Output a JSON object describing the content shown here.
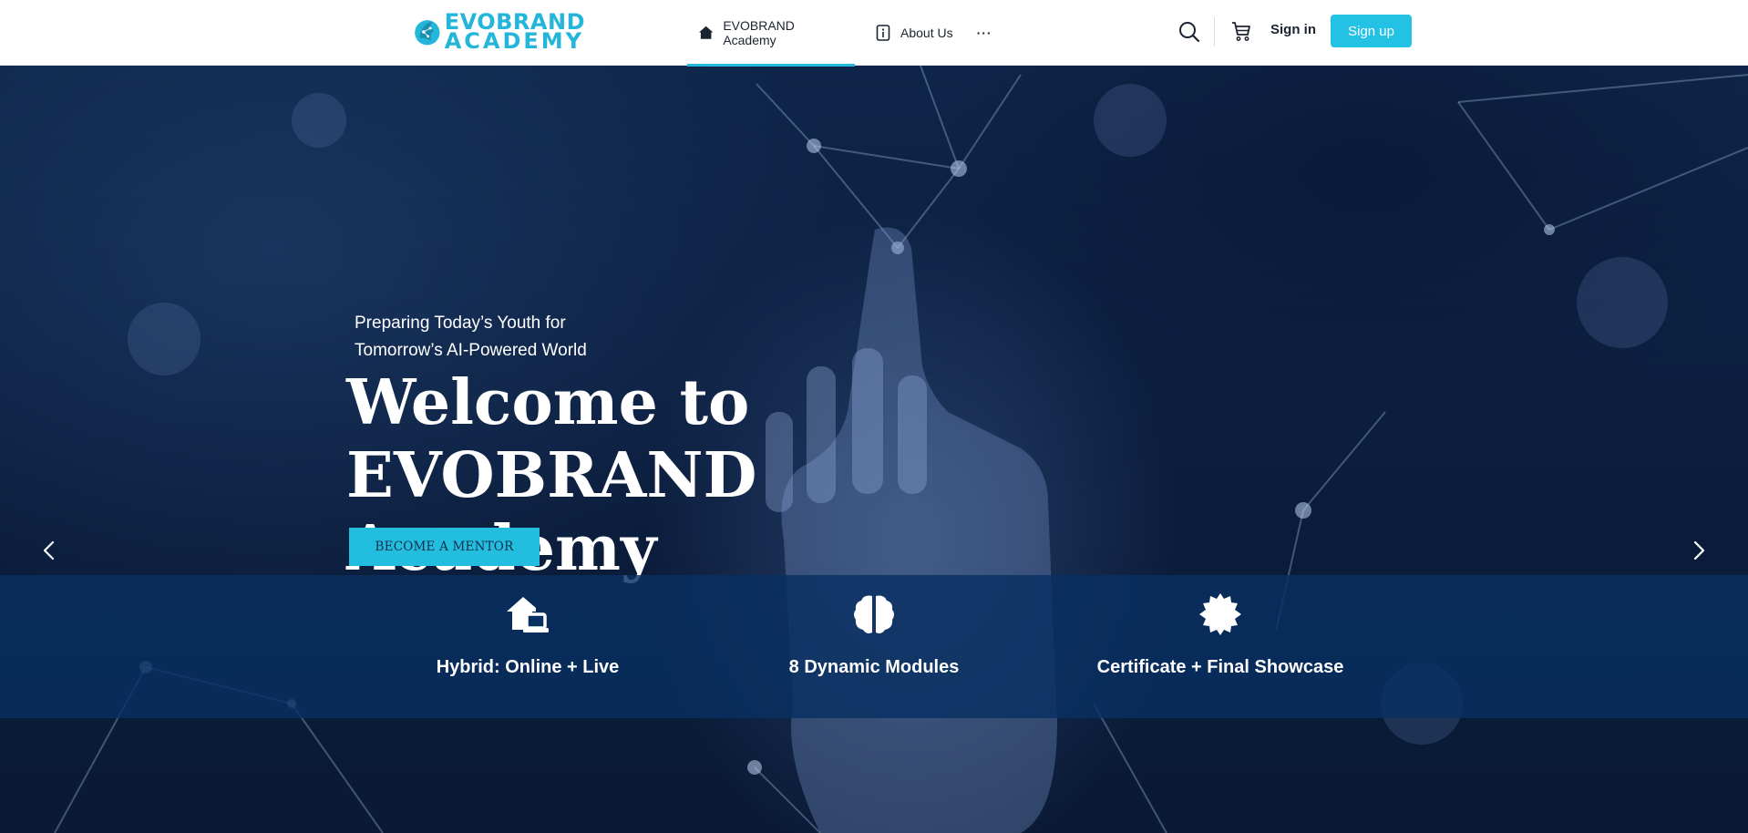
{
  "brand": {
    "logo_line1": "EVOBRAND",
    "logo_line2": "ACADEMY",
    "accent_color": "#23c1e4"
  },
  "nav": {
    "items": [
      {
        "label": "EVOBRAND Academy",
        "icon": "home-icon",
        "active": true
      },
      {
        "label": "About Us",
        "icon": "info-icon",
        "active": false
      }
    ],
    "more_label": "···"
  },
  "header_actions": {
    "search_icon": "search-icon",
    "cart_icon": "cart-icon",
    "sign_in_label": "Sign in",
    "sign_up_label": "Sign up"
  },
  "hero": {
    "tagline_line1": "Preparing Today’s Youth for",
    "tagline_line2": "Tomorrow’s AI-Powered World",
    "headline_line1": "Welcome to",
    "headline_line2": "EVOBRAND Academy",
    "cta_label": "BECOME A MENTOR",
    "prev_icon": "chevron-left-icon",
    "next_icon": "chevron-right-icon"
  },
  "features": [
    {
      "label": "Hybrid: Online + Live",
      "icon": "home-laptop-icon"
    },
    {
      "label": "8 Dynamic Modules",
      "icon": "brain-icon"
    },
    {
      "label": "Certificate + Final Showcase",
      "icon": "certificate-badge-icon"
    }
  ]
}
